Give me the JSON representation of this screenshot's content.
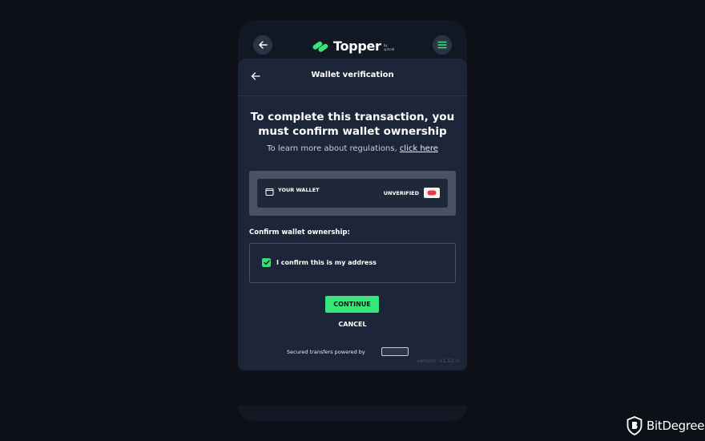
{
  "app": {
    "logo_text": "Topper",
    "logo_by": "by",
    "logo_sub": "uphold"
  },
  "header": {
    "title": "Wallet verification"
  },
  "main": {
    "headline_line1": "To complete this transaction, you",
    "headline_line2": "must confirm wallet ownership",
    "subline_text": "To learn more about regulations, ",
    "subline_link": "click here"
  },
  "wallet": {
    "label": "YOUR WALLET",
    "status": "UNVERIFIED"
  },
  "confirm": {
    "section_label": "Confirm wallet ownership:",
    "checkbox_label": "I confirm this is my address",
    "checked": true
  },
  "actions": {
    "continue_label": "CONTINUE",
    "cancel_label": "CANCEL"
  },
  "footer": {
    "powered_by": "Secured transfers powered by",
    "version": "version: v1.52.0"
  },
  "brand": {
    "name": "BitDegree"
  },
  "colors": {
    "accent_green": "#36e67b",
    "background": "#0d1016",
    "card": "#1d2638",
    "status_red": "#e8364a"
  },
  "icons": {
    "nav_back": "arrow-left-icon",
    "menu": "hamburger-menu-icon",
    "wallet": "wallet-icon",
    "unverified": "unverified-status-icon",
    "check": "checkmark-icon"
  }
}
